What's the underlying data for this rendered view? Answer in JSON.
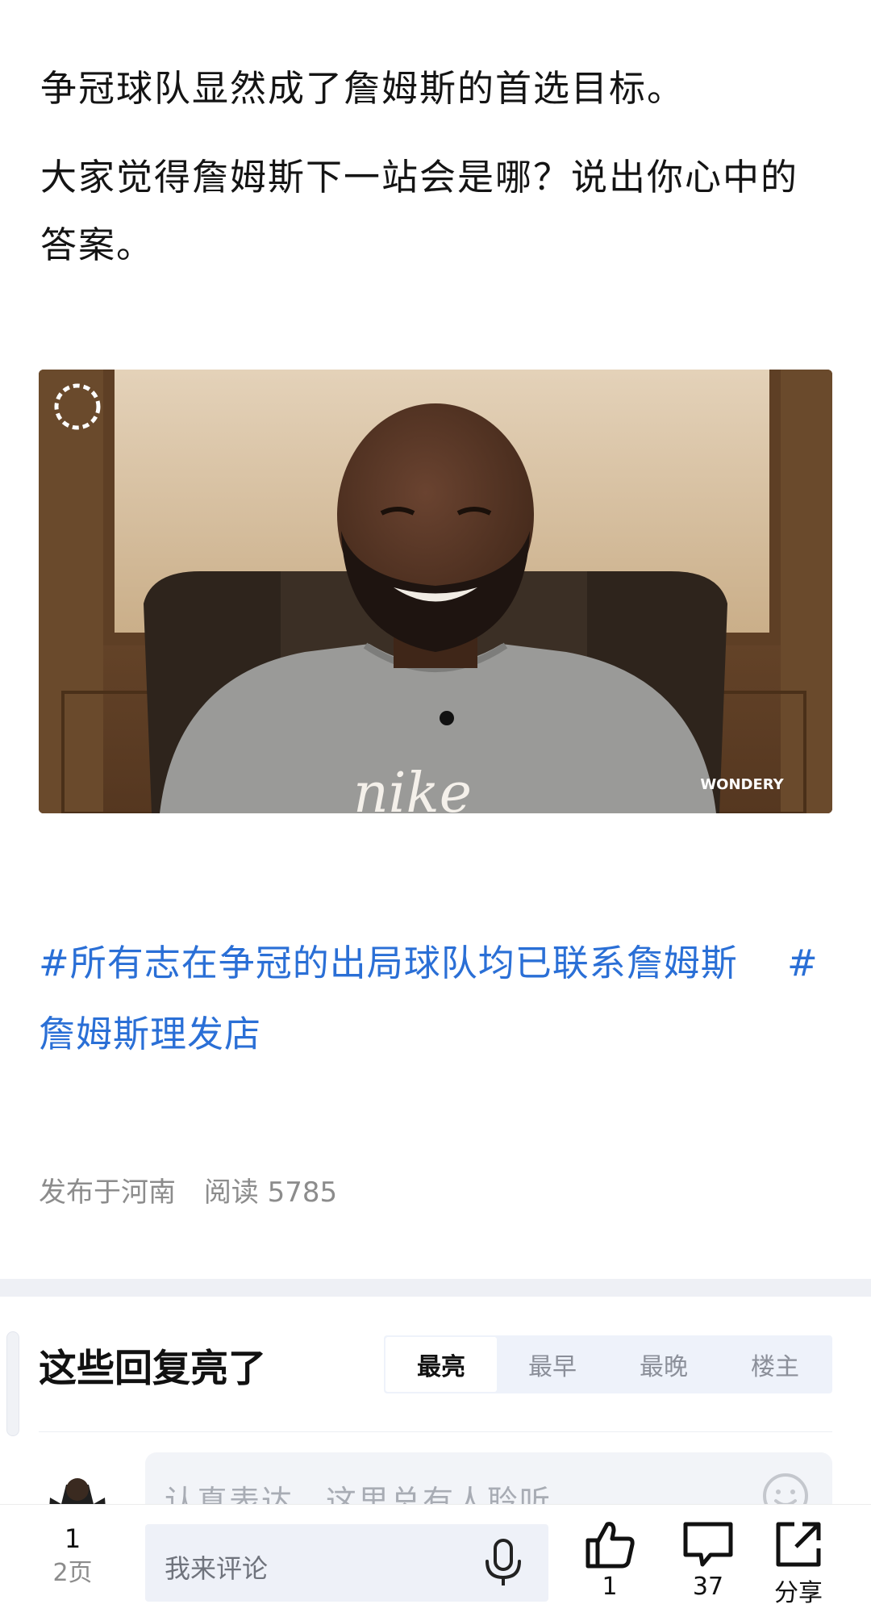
{
  "article": {
    "paragraphs": [
      "争冠球队显然成了詹姆斯的首选目标。",
      "大家觉得詹姆斯下一站会是哪？说出你心中的答案。"
    ],
    "image": {
      "watermark": "WONDERY",
      "shirt_text": "nike"
    },
    "hashtags": [
      "#所有志在争冠的出局球队均已联系詹姆斯",
      "#詹姆斯理发店"
    ],
    "meta": {
      "location": "发布于河南",
      "reads": "阅读 5785"
    }
  },
  "comments": {
    "title": "这些回复亮了",
    "sort_tabs": [
      {
        "label": "最亮",
        "active": true
      },
      {
        "label": "最早",
        "active": false
      },
      {
        "label": "最晚",
        "active": false
      },
      {
        "label": "楼主",
        "active": false
      }
    ],
    "compose_placeholder": "认真表达，这里总有人聆听"
  },
  "bottom_bar": {
    "page_current": "1",
    "page_total": "2页",
    "input_placeholder": "我来评论",
    "like_count": "1",
    "comment_count": "37",
    "share_label": "分享"
  },
  "colors": {
    "hashtag": "#2a6fd6",
    "meta": "#8c8c8c",
    "tabs_bg": "#eef2fa"
  }
}
